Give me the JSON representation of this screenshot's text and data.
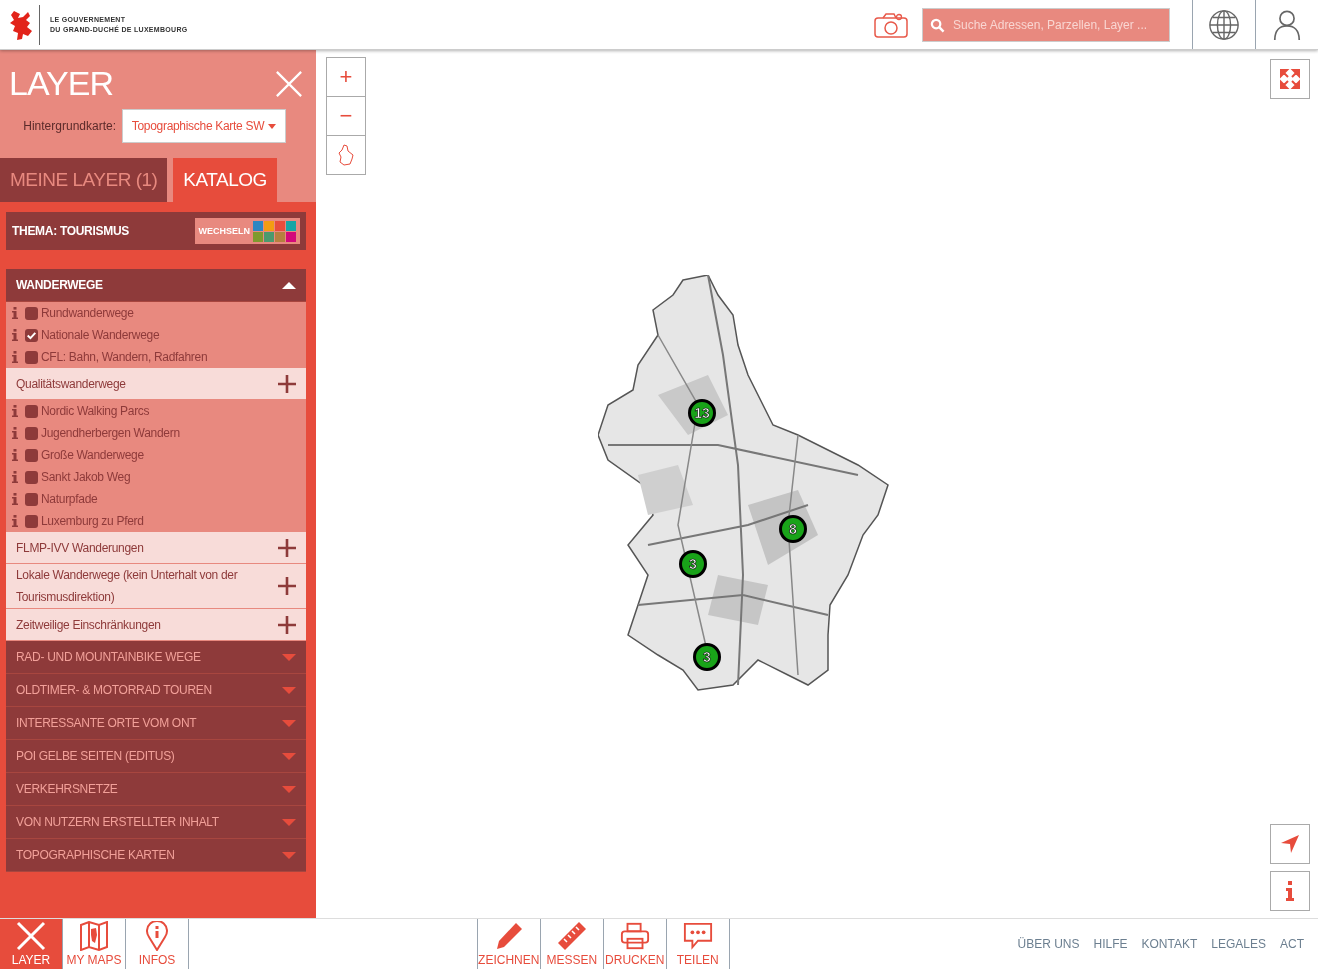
{
  "header": {
    "logo_text": [
      "LE GOUVERNEMENT",
      "DU GRAND-DUCHÉ DE LUXEMBOURG"
    ],
    "search": {
      "placeholder": "Suche Adressen, Parzellen, Layer ..."
    }
  },
  "panel": {
    "title": "LAYER",
    "basemap_label": "Hintergrundkarte:",
    "basemap_value": "Topographische Karte SW",
    "tabs": [
      {
        "label": "MEINE LAYER (1)",
        "selected": false
      },
      {
        "label": "KATALOG",
        "selected": true
      }
    ],
    "theme": {
      "label": "THEMA: TOURISMUS",
      "button": "WECHSELN",
      "swatches": [
        {
          "color": "#2e86c1"
        },
        {
          "color": "#f39c12"
        },
        {
          "color": "#e74c3c"
        },
        {
          "color": "#16a5a5"
        },
        {
          "color": "#7f9a2e"
        },
        {
          "color": "#4a9a6e"
        },
        {
          "color": "#b5803f"
        },
        {
          "color": "#d3087a"
        }
      ]
    },
    "catalog": [
      {
        "kind": "group",
        "label": "WANDERWEGE",
        "expanded": true,
        "children": [
          {
            "kind": "layer",
            "label": "Rundwanderwege",
            "checked": false
          },
          {
            "kind": "layer",
            "label": "Nationale Wanderwege",
            "checked": true
          },
          {
            "kind": "layer",
            "label": "CFL: Bahn, Wandern, Radfahren",
            "checked": false
          },
          {
            "kind": "subgroup",
            "label": "Qualitätswanderwege",
            "expanded": false
          },
          {
            "kind": "layer",
            "label": "Nordic Walking Parcs",
            "checked": false
          },
          {
            "kind": "layer",
            "label": "Jugendherbergen Wandern",
            "checked": false
          },
          {
            "kind": "layer",
            "label": "Große Wanderwege",
            "checked": false
          },
          {
            "kind": "layer",
            "label": "Sankt Jakob Weg",
            "checked": false
          },
          {
            "kind": "layer",
            "label": "Naturpfade",
            "checked": false
          },
          {
            "kind": "layer",
            "label": "Luxemburg zu Pferd",
            "checked": false
          },
          {
            "kind": "subgroup",
            "label": "FLMP-IVV Wanderungen",
            "expanded": false
          },
          {
            "kind": "subgroup",
            "label": "Lokale Wanderwege (kein Unterhalt von der Tourismusdirektion)",
            "expanded": false
          },
          {
            "kind": "subgroup",
            "label": "Zeitweilige Einschränkungen",
            "expanded": false
          }
        ]
      },
      {
        "kind": "group",
        "label": "RAD- UND MOUNTAINBIKE WEGE",
        "expanded": false
      },
      {
        "kind": "group",
        "label": "OLDTIMER- & MOTORRAD TOUREN",
        "expanded": false
      },
      {
        "kind": "group",
        "label": "INTERESSANTE ORTE VOM ONT",
        "expanded": false
      },
      {
        "kind": "group",
        "label": "POI GELBE SEITEN (EDITUS)",
        "expanded": false
      },
      {
        "kind": "group",
        "label": "VERKEHRSNETZE",
        "expanded": false
      },
      {
        "kind": "group",
        "label": "VON NUTZERN ERSTELLTER INHALT",
        "expanded": false
      },
      {
        "kind": "group",
        "label": "TOPOGRAPHISCHE KARTEN",
        "expanded": false
      }
    ]
  },
  "map": {
    "zoom_in": "+",
    "zoom_out": "−",
    "markers": [
      {
        "label": "13"
      },
      {
        "label": "8"
      },
      {
        "label": "3"
      },
      {
        "label": "3"
      }
    ]
  },
  "footer": {
    "left_tools": [
      {
        "label": "LAYER",
        "selected": true
      },
      {
        "label": "MY MAPS",
        "selected": false
      },
      {
        "label": "INFOS",
        "selected": false
      }
    ],
    "tools": [
      {
        "label": "ZEICHNEN"
      },
      {
        "label": "MESSEN"
      },
      {
        "label": "DRUCKEN"
      },
      {
        "label": "TEILEN"
      }
    ],
    "links": [
      "ÜBER UNS",
      "HILFE",
      "KONTAKT",
      "LEGALES",
      "ACT"
    ]
  }
}
